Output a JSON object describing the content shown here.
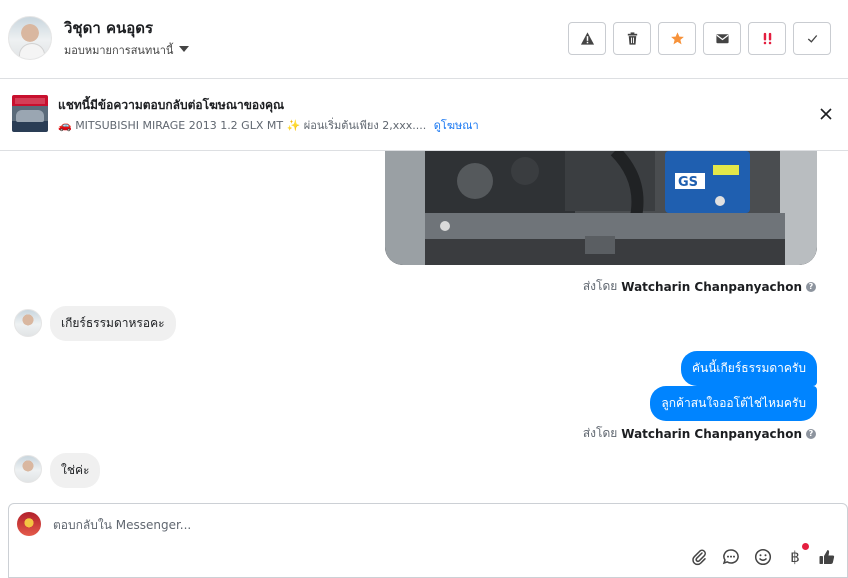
{
  "header": {
    "contact_name": "วิชุดา คนอุดร",
    "assign_label": "มอบหมายการสนทนานี้",
    "actions": [
      {
        "name": "report-spam",
        "icon": "warning-icon"
      },
      {
        "name": "delete",
        "icon": "trash-icon"
      },
      {
        "name": "star",
        "icon": "star-icon"
      },
      {
        "name": "mark-unread",
        "icon": "envelope-icon"
      },
      {
        "name": "follow-up",
        "icon": "exclamation-icon"
      },
      {
        "name": "mark-done",
        "icon": "check-icon"
      }
    ]
  },
  "ad_banner": {
    "title": "แชทนี้มีข้อความตอบกลับต่อโฆษณาของคุณ",
    "subtitle": "🚗 MITSUBISHI MIRAGE 2013 1.2 GLX MT ✨ ผ่อนเริ่มต้นเพียง 2,xxx....",
    "link_label": "ดูโฆษณา"
  },
  "messages": [
    {
      "type": "sent_by",
      "prefix": "ส่งโดย",
      "sender": "Watcharin Chanpanyachon"
    },
    {
      "type": "incoming",
      "text": "เกียร์ธรรมดาหรอคะ"
    },
    {
      "type": "outgoing",
      "text": "คันนี้เกียร์ธรรมดาครับ"
    },
    {
      "type": "outgoing",
      "text": "ลูกค้าสนใจออโต้ไช่ไหมครับ"
    },
    {
      "type": "sent_by",
      "prefix": "ส่งโดย",
      "sender": "Watcharin Chanpanyachon"
    },
    {
      "type": "incoming",
      "text": "ใช่ค่ะ"
    }
  ],
  "composer": {
    "placeholder": "ตอบกลับใน Messenger...",
    "tools": [
      "paperclip-icon",
      "chat-bubble-icon",
      "emoji-icon",
      "baht-icon",
      "thumbs-up-icon"
    ],
    "baht_symbol": "฿"
  },
  "colors": {
    "outgoing_bubble": "#0084ff",
    "incoming_bubble": "#f0f0f0",
    "star": "#f7923a",
    "follow_up": "#e41e3f",
    "link": "#1877f2"
  }
}
